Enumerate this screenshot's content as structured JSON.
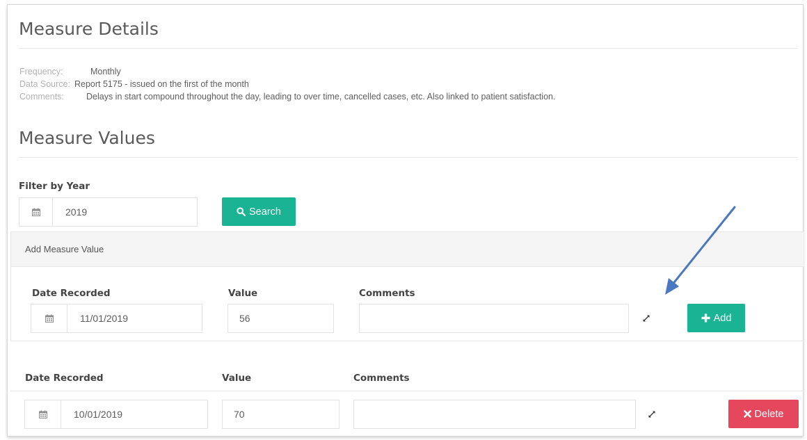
{
  "details": {
    "title": "Measure Details",
    "frequency_label": "Frequency:",
    "frequency_value": "Monthly",
    "data_source_label": "Data Source:",
    "data_source_value": "Report 5175 - issued on the first of the month",
    "comments_label": "Comments:",
    "comments_value": "Delays in start compound throughout the day, leading to over time, cancelled cases, etc. Also linked to patient satisfaction."
  },
  "values": {
    "title": "Measure Values",
    "filter_label": "Filter by Year",
    "filter_year": "2019",
    "search_label": "Search"
  },
  "add_form": {
    "header": "Add Measure Value",
    "date_label": "Date Recorded",
    "value_label": "Value",
    "comments_label": "Comments",
    "date_value": "11/01/2019",
    "value_value": "56",
    "comments_value": "",
    "add_label": "Add"
  },
  "records": {
    "date_header": "Date Recorded",
    "value_header": "Value",
    "comments_header": "Comments",
    "rows": [
      {
        "date": "10/01/2019",
        "value": "70",
        "comments": "",
        "delete_label": "Delete"
      }
    ]
  },
  "icons": {
    "calendar": "calendar-icon",
    "search": "search-icon",
    "plus": "plus-icon",
    "times": "times-icon",
    "expand": "expand-icon",
    "annotation_arrow": "annotation-arrow"
  },
  "colors": {
    "primary": "#1ab394",
    "danger": "#e5485d",
    "annotation_arrow": "#4a78c0"
  }
}
